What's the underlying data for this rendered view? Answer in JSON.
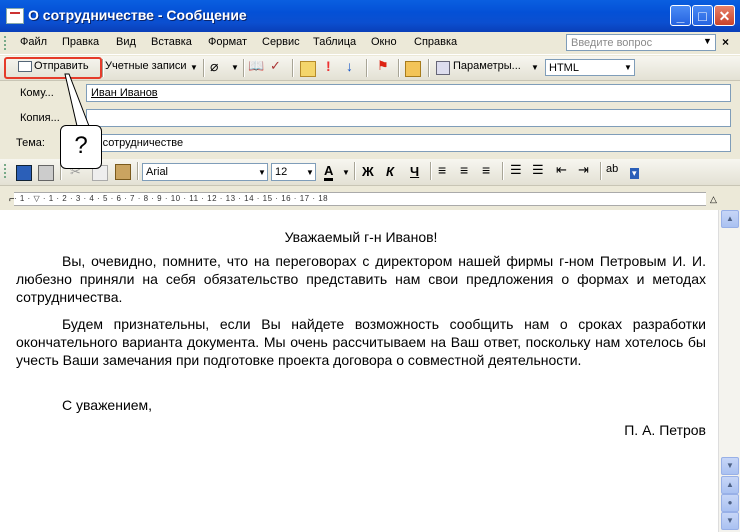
{
  "window": {
    "title": "О сотрудничестве - Сообщение"
  },
  "menu": {
    "items": [
      "Файл",
      "Правка",
      "Вид",
      "Вставка",
      "Формат",
      "Сервис",
      "Таблица",
      "Окно",
      "Справка"
    ],
    "ask_placeholder": "Введите вопрос"
  },
  "toolbar": {
    "send_label": "Отправить",
    "accounts_label": "Учетные записи",
    "params_label": "Параметры...",
    "format_value": "HTML"
  },
  "fields": {
    "to_label": "Кому...",
    "to_value": "Иван Иванов",
    "cc_label": "Копия...",
    "subject_label": "Тема:",
    "subject_value": "О сотрудничестве"
  },
  "format_bar": {
    "font": "Arial",
    "size": "12",
    "bold": "Ж",
    "italic": "К",
    "underline": "Ч"
  },
  "ruler": {
    "text": "· 1 · ▽ · 1 · 2 · 3 · 4 · 5 · 6 · 7 · 8 · 9 · 10 · 11 · 12 · 13 · 14 · 15 · 16 · 17 · 18"
  },
  "document": {
    "greeting": "Уважаемый г-н Иванов!",
    "para1": "Вы, очевидно, помните, что на переговорах с директором нашей фирмы г-ном Петровым И. И. любезно приняли на себя обязательство представить нам свои предложения о формах и методах сотрудничества.",
    "para2": "Будем признательны, если Вы найдете возможность сообщить нам о сроках разработки окончательного варианта документа. Мы очень рассчитываем на Ваш ответ, поскольку нам хотелось бы учесть Ваши замечания при подготовке проекта договора о совместной деятельности.",
    "closing": "С уважением,",
    "signature": "П. А. Петров"
  },
  "callout": {
    "text": "?"
  },
  "colors": {
    "titlebar": "#0a5fe0",
    "highlight": "#e53b2a"
  }
}
